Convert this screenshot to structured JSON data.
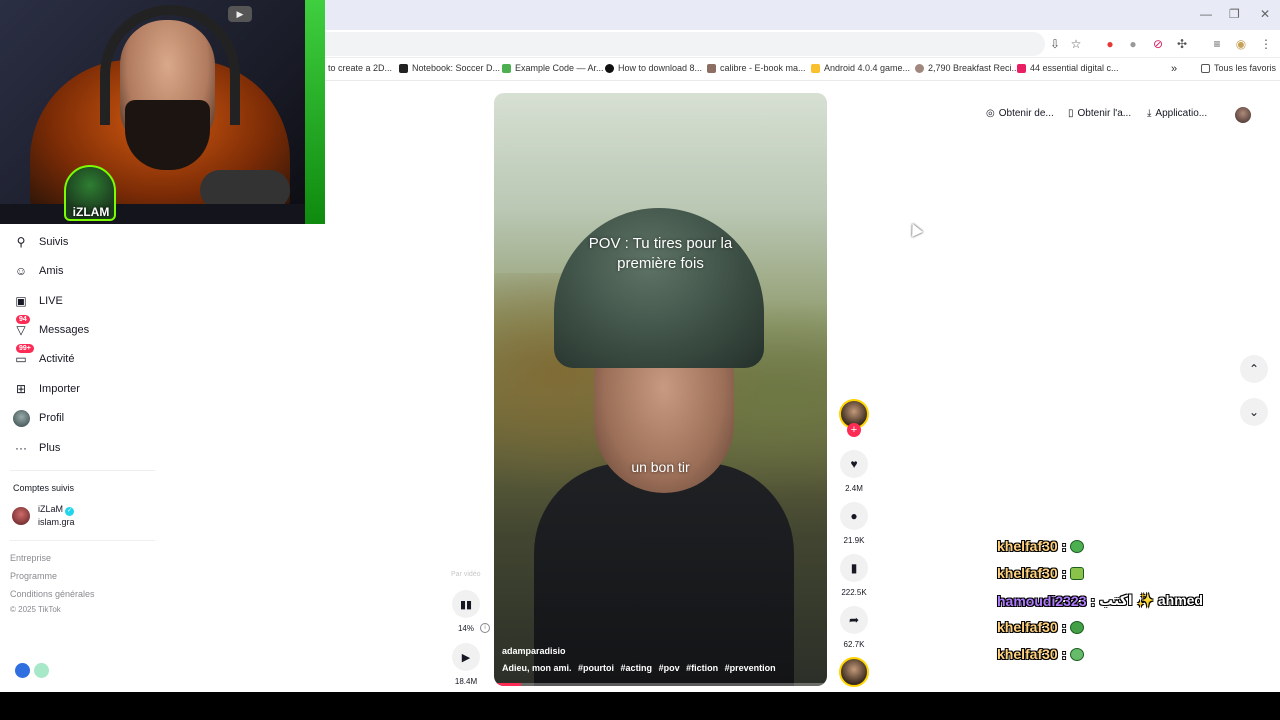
{
  "window": {
    "minimize": "—",
    "restore": "❐",
    "close": "✕"
  },
  "bookmarks": [
    {
      "label": "to create a 2D...",
      "color": "#ffffff"
    },
    {
      "label": "Notebook: Soccer D...",
      "color": "#222222"
    },
    {
      "label": "Example Code — Ar...",
      "color": "#4caf50"
    },
    {
      "label": "How to download 8...",
      "color": "#111111"
    },
    {
      "label": "calibre - E-book ma...",
      "color": "#8d6e63"
    },
    {
      "label": "Android 4.0.4 game...",
      "color": "#fbc02d"
    },
    {
      "label": "2,790 Breakfast Reci...",
      "color": "#a1887f"
    },
    {
      "label": "44 essential digital c...",
      "color": "#e91e63"
    }
  ],
  "bookmarks_more": "»",
  "bookmarks_all": "Tous les favoris",
  "webcam": {
    "channel_logo_text": "iZLAM"
  },
  "sidebar": {
    "items": [
      {
        "label": "Suivis",
        "icon": "person-plus-icon",
        "glyph": "⚲",
        "badge": ""
      },
      {
        "label": "Amis",
        "icon": "friends-icon",
        "glyph": "☺",
        "badge": ""
      },
      {
        "label": "LIVE",
        "icon": "live-icon",
        "glyph": "▣",
        "badge": ""
      },
      {
        "label": "Messages",
        "icon": "messages-icon",
        "glyph": "▽",
        "badge": "94"
      },
      {
        "label": "Activité",
        "icon": "activity-icon",
        "glyph": "▭",
        "badge": "99+"
      },
      {
        "label": "Importer",
        "icon": "upload-icon",
        "glyph": "⊞",
        "badge": ""
      },
      {
        "label": "Profil",
        "icon": "profile-avatar",
        "glyph": "●",
        "badge": ""
      },
      {
        "label": "Plus",
        "icon": "more-icon",
        "glyph": "···",
        "badge": ""
      }
    ],
    "followed_title": "Comptes suivis",
    "followed_account": {
      "name": "iZLaM",
      "handle": "islam.gra"
    },
    "footer_links": [
      "Entreprise",
      "Programme",
      "Conditions générales"
    ],
    "copyright": "© 2025 TikTok"
  },
  "video": {
    "overlay_title_line1": "POV : Tu tires pour la",
    "overlay_title_line2": "première fois",
    "subtitle": "un bon tir",
    "author": "adamparadisio",
    "caption": "Adieu, mon ami.",
    "hashtags": [
      "#pourtoi",
      "#acting",
      "#pov",
      "#fiction",
      "#prevention"
    ],
    "progress_fraction": 0.08
  },
  "actions": {
    "likes": "2.4M",
    "comments": "21.9K",
    "saves": "222.5K",
    "shares": "62.7K"
  },
  "stats": {
    "label": "Par vidéo",
    "percent": "14%",
    "views": "18.4M"
  },
  "top_right": {
    "get_coins": "Obtenir de...",
    "get_app": "Obtenir l'a...",
    "application": "Applicatio..."
  },
  "chat": [
    {
      "user": "khelfaf30",
      "color": "#ffd27f",
      "text": ""
    },
    {
      "user": "khelfaf30",
      "color": "#ffd27f",
      "text": ""
    },
    {
      "user": "hamoudi2323",
      "color": "#b07cff",
      "text": "اكتب ✨ ahmed"
    },
    {
      "user": "khelfaf30",
      "color": "#ffd27f",
      "text": ""
    },
    {
      "user": "khelfaf30",
      "color": "#ffd27f",
      "text": ""
    }
  ]
}
